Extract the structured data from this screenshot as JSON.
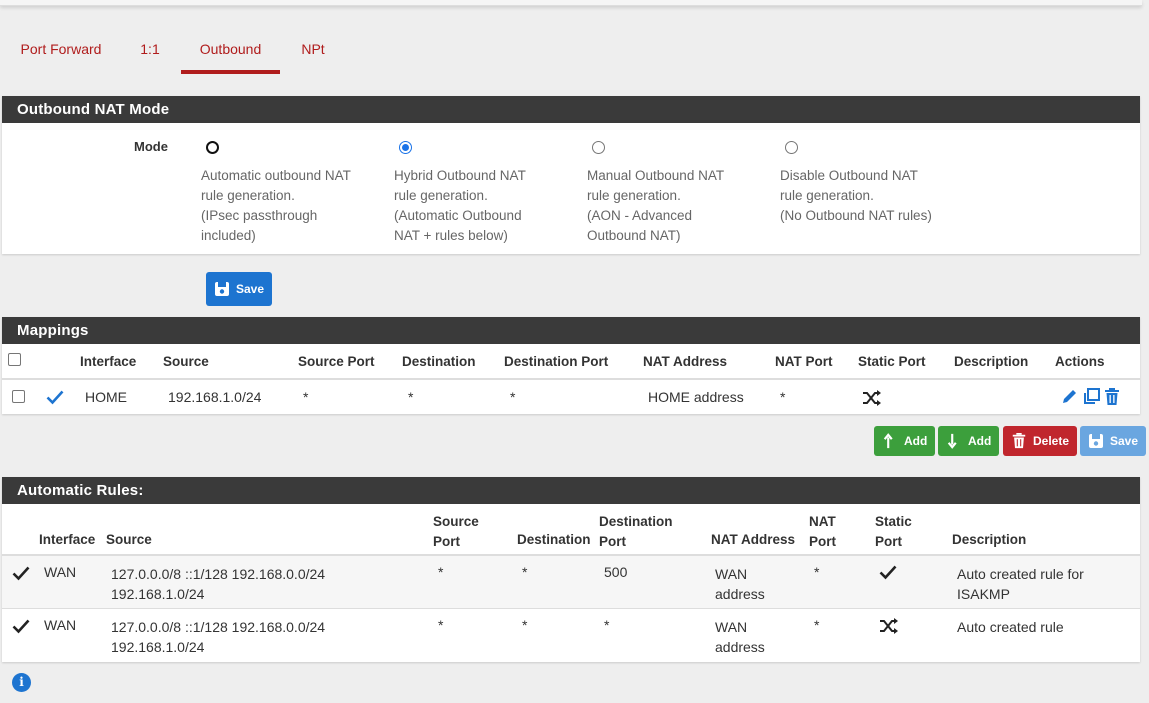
{
  "tabs": [
    "Port Forward",
    "1:1",
    "Outbound",
    "NPt"
  ],
  "active_tab": "Outbound",
  "mode_panel": {
    "title": "Outbound NAT Mode",
    "mode_label": "Mode",
    "options": [
      {
        "line1": "Automatic outbound NAT",
        "line2": "rule generation.",
        "line3": "(IPsec passthrough",
        "line4": "included)",
        "selected": false
      },
      {
        "line1": "Hybrid Outbound NAT",
        "line2": "rule generation.",
        "line3": "(Automatic Outbound",
        "line4": "NAT + rules below)",
        "selected": true
      },
      {
        "line1": "Manual Outbound NAT",
        "line2": "rule generation.",
        "line3": "(AON - Advanced",
        "line4": "Outbound NAT)",
        "selected": false
      },
      {
        "line1": "Disable Outbound NAT",
        "line2": "rule generation.",
        "line3": "(No Outbound NAT rules)",
        "line4": "",
        "selected": false
      }
    ],
    "save_label": "Save"
  },
  "mappings": {
    "title": "Mappings",
    "headers": [
      "Interface",
      "Source",
      "Source Port",
      "Destination",
      "Destination Port",
      "NAT Address",
      "NAT Port",
      "Static Port",
      "Description",
      "Actions"
    ],
    "rows": [
      {
        "interface": "HOME",
        "source": "192.168.1.0/24",
        "source_port": "*",
        "destination": "*",
        "destination_port": "*",
        "nat_address": "HOME address",
        "nat_port": "*",
        "static_port_icon": "shuffle-icon",
        "description": ""
      }
    ],
    "buttons": {
      "add_top": "Add",
      "add_bottom": "Add",
      "delete": "Delete",
      "save": "Save"
    }
  },
  "automatic_rules": {
    "title": "Automatic Rules:",
    "headers": {
      "interface": "Interface",
      "source": "Source",
      "source_port_1": "Source",
      "source_port_2": "Port",
      "destination": "Destination",
      "destination_port_1": "Destination",
      "destination_port_2": "Port",
      "nat_address": "NAT Address",
      "nat_port_1": "NAT",
      "nat_port_2": "Port",
      "static_port_1": "Static",
      "static_port_2": "Port",
      "description": "Description"
    },
    "rows": [
      {
        "interface": "WAN",
        "source_1": "127.0.0.0/8 ::1/128 192.168.0.0/24",
        "source_2": "192.168.1.0/24",
        "source_port": "*",
        "destination": "*",
        "destination_port": "500",
        "nat_address_1": "WAN",
        "nat_address_2": "address",
        "nat_port": "*",
        "static_port_icon": "check-icon",
        "description_1": "Auto created rule for",
        "description_2": "ISAKMP"
      },
      {
        "interface": "WAN",
        "source_1": "127.0.0.0/8 ::1/128 192.168.0.0/24",
        "source_2": "192.168.1.0/24",
        "source_port": "*",
        "destination": "*",
        "destination_port": "*",
        "nat_address_1": "WAN",
        "nat_address_2": "address",
        "nat_port": "*",
        "static_port_icon": "shuffle-icon",
        "description_1": "Auto created rule",
        "description_2": ""
      }
    ]
  },
  "colors": {
    "accent": "#b01c1c",
    "panel_header": "#3a3a3a",
    "primary": "#1d74d0",
    "success": "#3c9f3c",
    "danger": "#c0262d"
  }
}
